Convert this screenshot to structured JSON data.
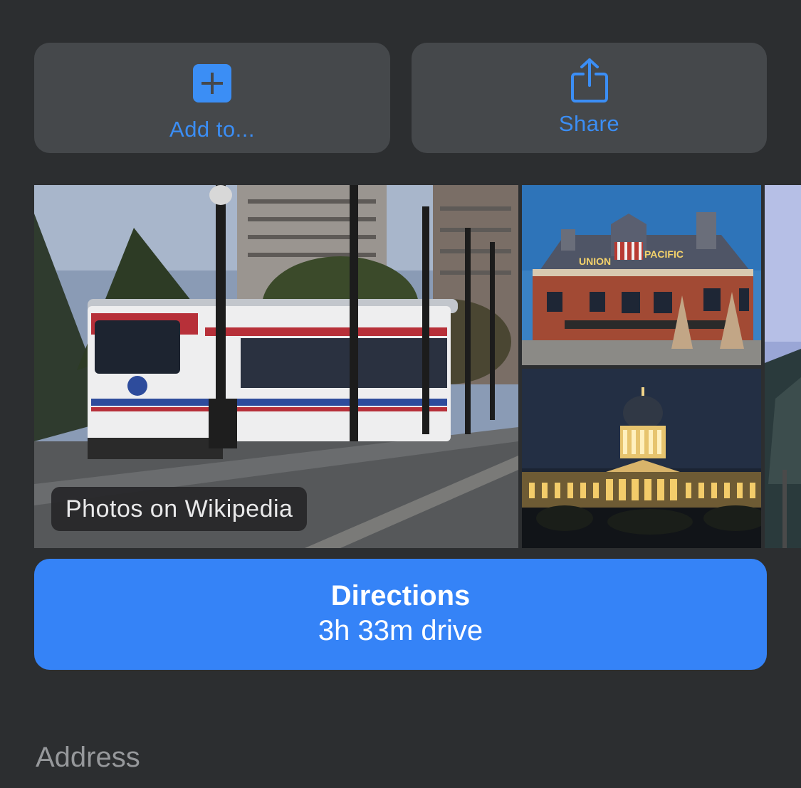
{
  "actions": {
    "add_label": "Add to...",
    "share_label": "Share"
  },
  "photos": {
    "badge": "Photos on Wikipedia",
    "upper_sign_left": "UNION",
    "upper_sign_right": "PACIFIC"
  },
  "directions": {
    "title": "Directions",
    "subtitle": "3h 33m drive"
  },
  "address": {
    "label": "Address"
  },
  "colors": {
    "accent": "#3b8ef5",
    "button": "#3583f7",
    "card": "#45484b",
    "background": "#2c2e30"
  }
}
